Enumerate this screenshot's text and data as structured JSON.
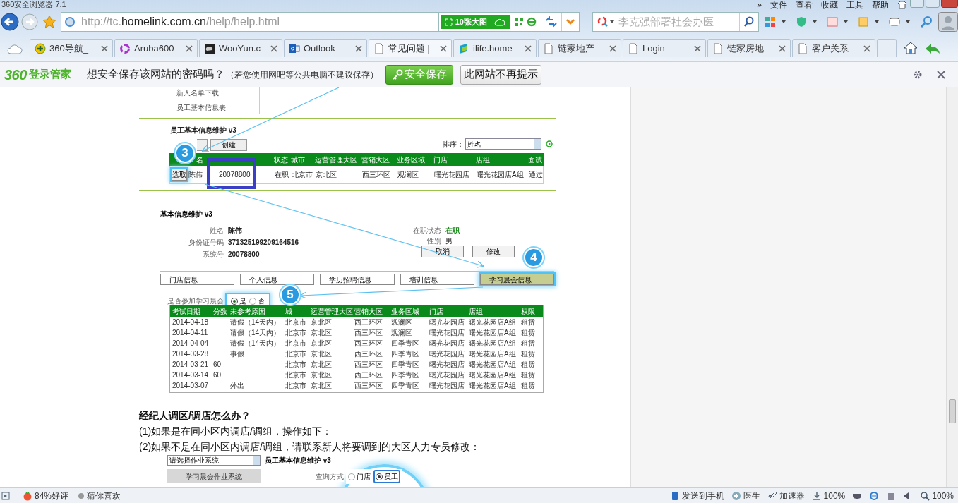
{
  "window": {
    "title": "360安全浏览器 7.1",
    "menu": [
      "»",
      "文件",
      "查看",
      "收藏",
      "工具",
      "帮助"
    ]
  },
  "toolbar": {
    "url_prefix": "http://tc.",
    "url_domain": "homelink.com.cn",
    "url_path": "/help/help.html",
    "bigpic_button": "10张大图",
    "search_placeholder": "李克强部署社会办医"
  },
  "tabs": [
    {
      "label": "360导航_",
      "selected": false,
      "kind": "nav"
    },
    {
      "label": "Aruba600",
      "selected": false,
      "kind": "ring"
    },
    {
      "label": "WooYun.c",
      "selected": false,
      "kind": "dark"
    },
    {
      "label": "Outlook",
      "selected": false,
      "kind": "outlook"
    },
    {
      "label": "常见问题 |",
      "selected": true,
      "kind": "page"
    },
    {
      "label": "ilife.home",
      "selected": false,
      "kind": "ilife"
    },
    {
      "label": "链家地产",
      "selected": false,
      "kind": "page"
    },
    {
      "label": "Login",
      "selected": false,
      "kind": "page"
    },
    {
      "label": "链家房地",
      "selected": false,
      "kind": "page"
    },
    {
      "label": "客户关系",
      "selected": false,
      "kind": "page"
    }
  ],
  "password_bar": {
    "brand": "360",
    "brand_label": "登录管家",
    "question": "想安全保存该网站的密码吗？",
    "note": "（若您使用网吧等公共电脑不建议保存）",
    "save_button": "安全保存",
    "dismiss_button": "此网站不再提示"
  },
  "help": {
    "figure_1": {
      "menu_items": [
        "新人名单下载",
        "员工基本信息表"
      ],
      "title": "员工基本信息维护 v3",
      "create_button": "创建",
      "sort_label": "排序：",
      "sort_value": "姓名",
      "columns": [
        {},
        {
          "label": "名"
        },
        {},
        {},
        {
          "label": "状态"
        },
        {
          "label": "城市"
        },
        {
          "label": "运营管理大区"
        },
        {
          "label": "营销大区"
        },
        {
          "label": "业务区域"
        },
        {
          "label": "门店"
        },
        {
          "label": "店组"
        },
        {
          "label": "面试"
        }
      ],
      "row": {
        "select_button": "选取",
        "cells": [
          "陈伟",
          "20078800",
          "",
          "在职",
          "北京市",
          "京北区",
          "西三环区",
          "观澜区",
          "曙光花园店",
          "曙光花园店A组",
          "通过"
        ]
      }
    },
    "figure_2": {
      "title": "基本信息维护 v3",
      "fields_left": [
        {
          "label": "姓名",
          "value": "陈伟"
        },
        {
          "label": "身份证号码",
          "value": "371325199209164516"
        },
        {
          "label": "系统号",
          "value": "20078800"
        }
      ],
      "fields_right": [
        {
          "label": "在职状态",
          "value": "在职",
          "kind": "status"
        },
        {
          "label": "性别",
          "value": "男",
          "kind": "plain"
        }
      ],
      "buttons": [
        "取消",
        "修改"
      ],
      "tabs": [
        {
          "label": "门店信息",
          "selected": false
        },
        {
          "label": "个人信息",
          "selected": false
        },
        {
          "label": "学历招聘信息",
          "selected": false
        },
        {
          "label": "培训信息",
          "selected": false
        },
        {
          "label": "学习晨会信息",
          "selected": true
        }
      ],
      "question": "是否参加学习晨会",
      "options": [
        {
          "label": "是",
          "selected": true
        },
        {
          "label": "否",
          "selected": false
        }
      ],
      "columns": [
        "考试日期",
        "分数",
        "未参考原因",
        "城",
        "运营管理大区",
        "营销大区",
        "业务区域",
        "门店",
        "店组",
        "权限"
      ],
      "rows": [
        [
          "2014-04-18",
          "",
          "请假（14天内）",
          "北京市",
          "京北区",
          "西三环区",
          "观澜区",
          "曙光花园店",
          "曙光花园店A组",
          "租赁"
        ],
        [
          "2014-04-11",
          "",
          "请假（14天内）",
          "北京市",
          "京北区",
          "西三环区",
          "观澜区",
          "曙光花园店",
          "曙光花园店A组",
          "租赁"
        ],
        [
          "2014-04-04",
          "",
          "请假（14天内）",
          "北京市",
          "京北区",
          "西三环区",
          "四季青区",
          "曙光花园店",
          "曙光花园店A组",
          "租赁"
        ],
        [
          "2014-03-28",
          "",
          "事假",
          "北京市",
          "京北区",
          "西三环区",
          "四季青区",
          "曙光花园店",
          "曙光花园店A组",
          "租赁"
        ],
        [
          "2014-03-21",
          "60",
          "",
          "北京市",
          "京北区",
          "西三环区",
          "四季青区",
          "曙光花园店",
          "曙光花园店A组",
          "租赁"
        ],
        [
          "2014-03-14",
          "60",
          "",
          "北京市",
          "京北区",
          "西三环区",
          "四季青区",
          "曙光花园店",
          "曙光花园店A组",
          "租赁"
        ],
        [
          "2014-03-07",
          "",
          "外出",
          "北京市",
          "京北区",
          "西三环区",
          "四季青区",
          "曙光花园店",
          "曙光花园店A组",
          "租赁"
        ]
      ]
    },
    "heading": "经纪人调区/调店怎么办？",
    "paragraphs": [
      "(1)如果是在同小区内调店/调组，操作如下：",
      "(2)如果不是在同小区内调店/调组，请联系新人将要调到的大区人力专员修改："
    ],
    "figure_3": {
      "select_value": "请选择作业系统",
      "system_button": "学习晨会作业系统",
      "title": "员工基本信息维护 v3",
      "query_label": "查询方式",
      "options": [
        {
          "label": "门店",
          "selected": false
        },
        {
          "label": "员工",
          "selected": true
        }
      ]
    },
    "badges": [
      "3",
      "4",
      "5"
    ]
  },
  "status_bar": {
    "rating": "84%好评",
    "guess": "猜你喜欢",
    "send": "发送到手机",
    "doctor": "医生",
    "accelerator": "加速器",
    "download": "100%",
    "zoom": "100%"
  }
}
